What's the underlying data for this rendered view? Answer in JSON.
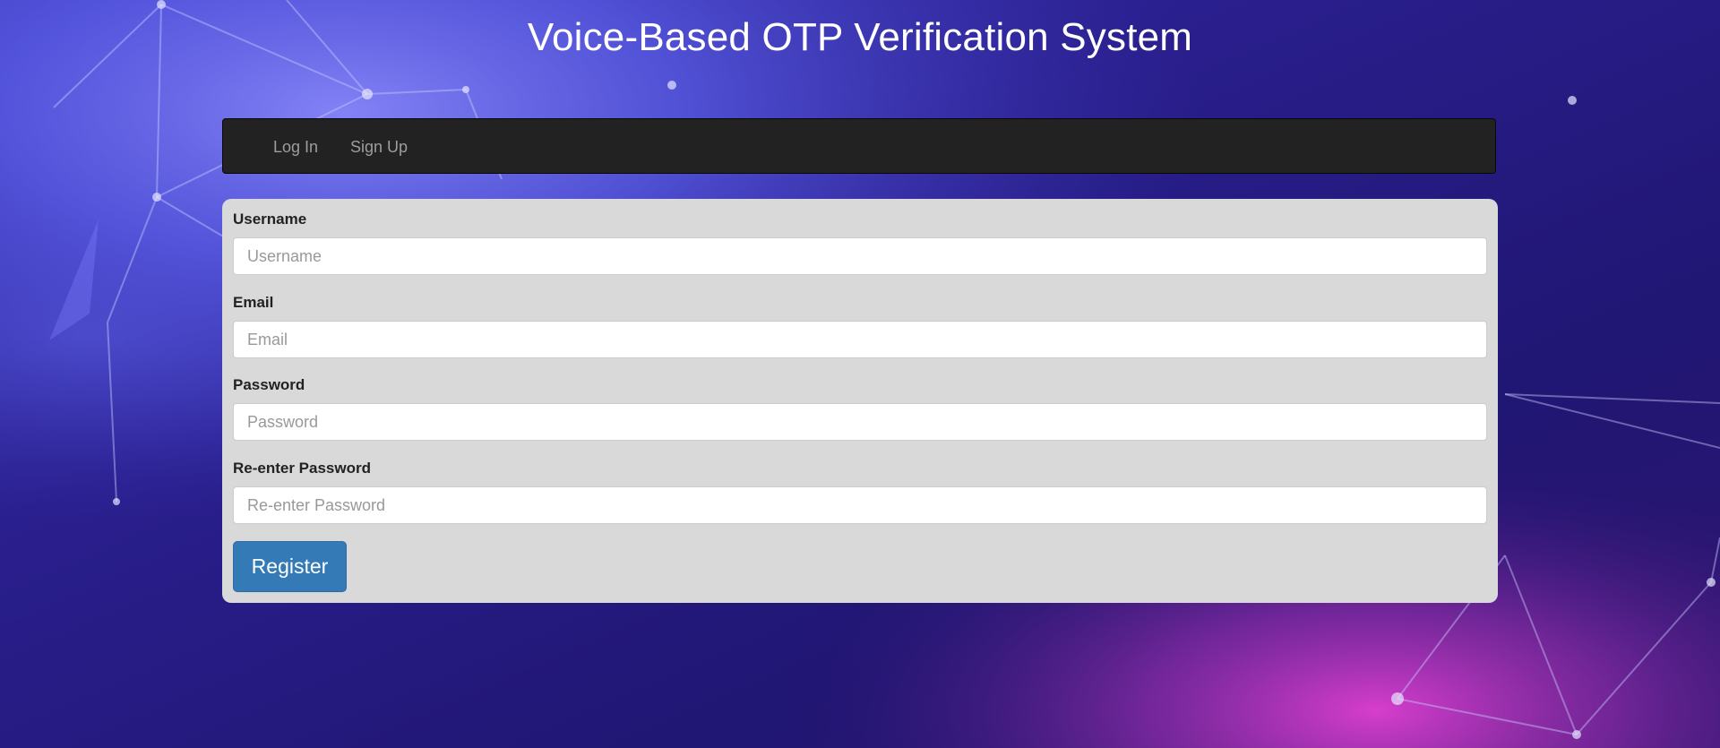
{
  "page": {
    "title": "Voice-Based OTP Verification System"
  },
  "navbar": {
    "items": [
      {
        "label": "Log In"
      },
      {
        "label": "Sign Up"
      }
    ]
  },
  "form": {
    "fields": [
      {
        "label": "Username",
        "placeholder": "Username",
        "value": ""
      },
      {
        "label": "Email",
        "placeholder": "Email",
        "value": ""
      },
      {
        "label": "Password",
        "placeholder": "Password",
        "value": ""
      },
      {
        "label": "Re-enter Password",
        "placeholder": "Re-enter Password",
        "value": ""
      }
    ],
    "submit_label": "Register"
  },
  "colors": {
    "background_dark": "#241a78",
    "background_glow_blue": "#6b6ff0",
    "background_glow_magenta": "#d23cc8",
    "navbar_bg": "#222222",
    "nav_link": "#9d9d9d",
    "panel_bg": "#d9d9d9",
    "button_primary": "#337ab7"
  }
}
